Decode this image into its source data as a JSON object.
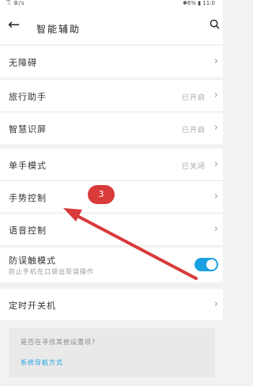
{
  "status_bar": {
    "left": "ᵢ᷈ᵢ᷈ B/s",
    "right": "✱6% ▮ 11:0"
  },
  "header": {
    "title": "智能辅助"
  },
  "settings": {
    "accessibility": "无障碍",
    "travel_assistant": {
      "label": "旅行助手",
      "status": "已开启"
    },
    "smart_screen": {
      "label": "智慧识屏",
      "status": "已开启"
    },
    "one_hand": {
      "label": "单手模式",
      "status": "已关闭"
    },
    "gesture_control": "手势控制",
    "voice_control": "语音控制",
    "prevent_mistouch": {
      "label": "防误触模式",
      "subtitle": "防止手机在口袋出现误操作",
      "enabled": true
    },
    "scheduled_power": "定时开关机"
  },
  "hint": {
    "question": "是否在寻找其他设置项?",
    "link": "系统导航方式"
  },
  "annotation": {
    "badge": "3"
  },
  "colors": {
    "accent": "#1aa1e1",
    "badge": "#d93a3a",
    "arrow": "#d93a3a"
  },
  "icons": {
    "back": "back-arrow-icon",
    "search": "search-icon",
    "chevron": "chevron-right-icon"
  }
}
